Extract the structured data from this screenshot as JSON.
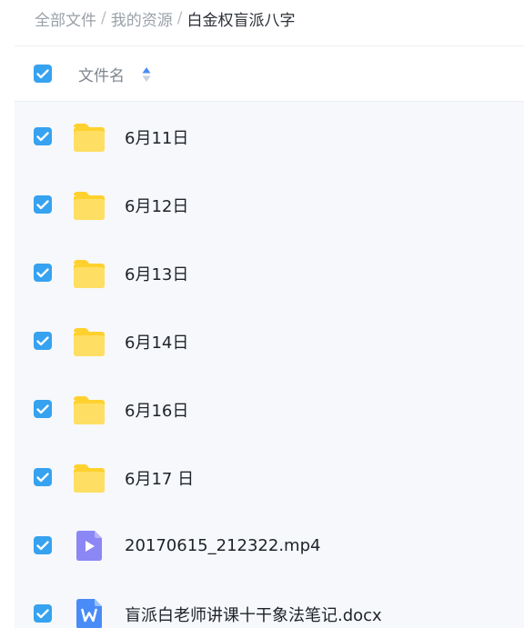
{
  "breadcrumb": {
    "items": [
      "全部文件",
      "我的资源"
    ],
    "separator": "/",
    "current": "白金权盲派八字"
  },
  "table": {
    "column_name": "文件名",
    "rows": [
      {
        "name": "6月11日",
        "type": "folder",
        "checked": true
      },
      {
        "name": "6月12日",
        "type": "folder",
        "checked": true
      },
      {
        "name": "6月13日",
        "type": "folder",
        "checked": true
      },
      {
        "name": "6月14日",
        "type": "folder",
        "checked": true
      },
      {
        "name": "6月16日",
        "type": "folder",
        "checked": true
      },
      {
        "name": "6月17 日",
        "type": "folder",
        "checked": true
      },
      {
        "name": "20170615_212322.mp4",
        "type": "video",
        "checked": true
      },
      {
        "name": "盲派白老师讲课十干象法笔记.docx",
        "type": "word",
        "checked": true
      }
    ]
  },
  "colors": {
    "checkbox": "#36a2f0",
    "folder": "#ffd12e",
    "video": "#8b87f5",
    "word": "#4a8cf7"
  }
}
